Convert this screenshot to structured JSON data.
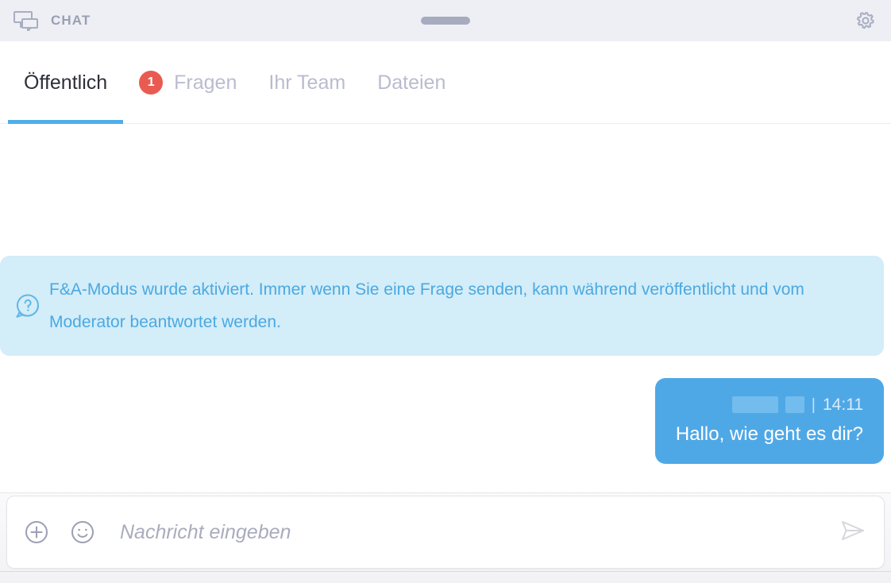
{
  "header": {
    "title": "CHAT",
    "chat_icon": "chat-bubbles-icon",
    "settings_icon": "gear-icon",
    "drag_handle": "drag-handle",
    "background_color": "#eeeff4"
  },
  "tabs": [
    {
      "label": "Öffentlich",
      "active": true,
      "badge": null
    },
    {
      "label": "Fragen",
      "active": false,
      "badge": "1"
    },
    {
      "label": "Ihr Team",
      "active": false,
      "badge": null
    },
    {
      "label": "Dateien",
      "active": false,
      "badge": null
    }
  ],
  "tab_accent_color": "#4fadea",
  "badge_color": "#e95b51",
  "system_note": {
    "icon": "question-bubble-icon",
    "text": "F&A-Modus wurde aktiviert. Immer wenn Sie eine Frage senden, kann während veröffentlicht und vom Moderator beantwortet werden.",
    "background_color": "#d3edf9",
    "text_color": "#4ba9e0"
  },
  "messages": [
    {
      "author": "",
      "author_redacted": true,
      "separator": "|",
      "time": "14:11",
      "text": "Hallo, wie geht es dir?",
      "outgoing": true,
      "bubble_color": "#4fa8e6"
    }
  ],
  "composer": {
    "attach_icon": "plus-circle-icon",
    "emoji_icon": "smiley-icon",
    "placeholder": "Nachricht eingeben",
    "value": "",
    "send_icon": "send-paper-plane-icon"
  }
}
